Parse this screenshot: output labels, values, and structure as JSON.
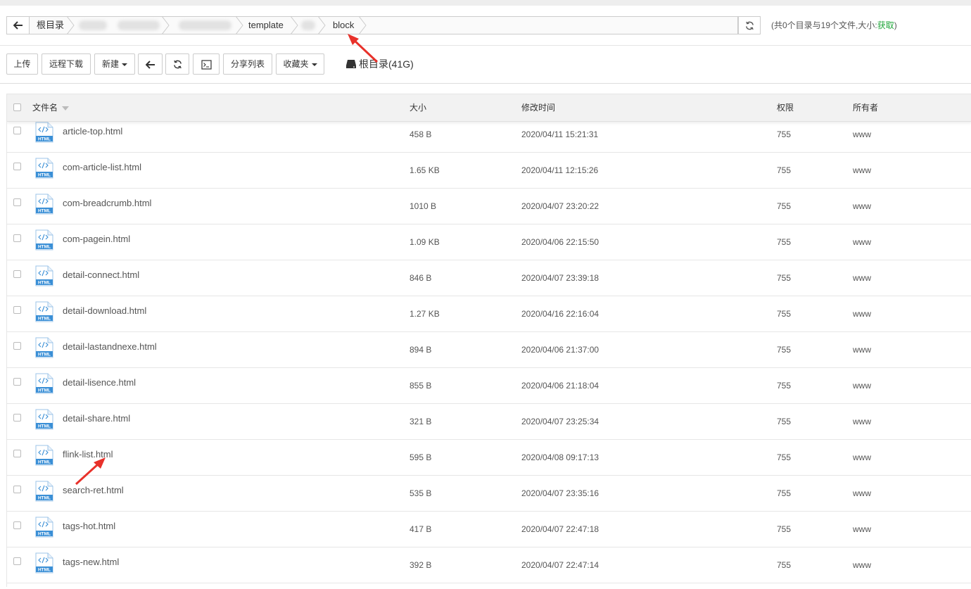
{
  "breadcrumb": {
    "root": "根目录",
    "template": "template",
    "block": "block"
  },
  "dir_info": {
    "prefix": "(共0个目录与19个文件,大小:",
    "link": "获取",
    "suffix": ")"
  },
  "toolbar": {
    "upload": "上传",
    "remote_download": "远程下载",
    "new": "新建",
    "share_list": "分享列表",
    "favorites": "收藏夹",
    "disk": "根目录(41G)"
  },
  "table": {
    "headers": {
      "name": "文件名",
      "size": "大小",
      "mtime": "修改时间",
      "perm": "权限",
      "owner": "所有者"
    },
    "icon_badge": "HTML",
    "rows": [
      {
        "name": "article-top.html",
        "size": "458 B",
        "mtime": "2020/04/11 15:21:31",
        "perm": "755",
        "owner": "www"
      },
      {
        "name": "com-article-list.html",
        "size": "1.65 KB",
        "mtime": "2020/04/11 12:15:26",
        "perm": "755",
        "owner": "www"
      },
      {
        "name": "com-breadcrumb.html",
        "size": "1010 B",
        "mtime": "2020/04/07 23:20:22",
        "perm": "755",
        "owner": "www"
      },
      {
        "name": "com-pagein.html",
        "size": "1.09 KB",
        "mtime": "2020/04/06 22:15:50",
        "perm": "755",
        "owner": "www"
      },
      {
        "name": "detail-connect.html",
        "size": "846 B",
        "mtime": "2020/04/07 23:39:18",
        "perm": "755",
        "owner": "www"
      },
      {
        "name": "detail-download.html",
        "size": "1.27 KB",
        "mtime": "2020/04/16 22:16:04",
        "perm": "755",
        "owner": "www"
      },
      {
        "name": "detail-lastandnexe.html",
        "size": "894 B",
        "mtime": "2020/04/06 21:37:00",
        "perm": "755",
        "owner": "www"
      },
      {
        "name": "detail-lisence.html",
        "size": "855 B",
        "mtime": "2020/04/06 21:18:04",
        "perm": "755",
        "owner": "www"
      },
      {
        "name": "detail-share.html",
        "size": "321 B",
        "mtime": "2020/04/07 23:25:34",
        "perm": "755",
        "owner": "www"
      },
      {
        "name": "flink-list.html",
        "size": "595 B",
        "mtime": "2020/04/08 09:17:13",
        "perm": "755",
        "owner": "www"
      },
      {
        "name": "search-ret.html",
        "size": "535 B",
        "mtime": "2020/04/07 23:35:16",
        "perm": "755",
        "owner": "www"
      },
      {
        "name": "tags-hot.html",
        "size": "417 B",
        "mtime": "2020/04/07 22:47:18",
        "perm": "755",
        "owner": "www"
      },
      {
        "name": "tags-new.html",
        "size": "392 B",
        "mtime": "2020/04/07 22:47:14",
        "perm": "755",
        "owner": "www"
      }
    ]
  },
  "colors": {
    "accent_green": "#20a53a",
    "icon_blue": "#3a8fd6",
    "annotation_red": "#e8312a"
  },
  "icons": {
    "back": "arrow-left-icon",
    "refresh": "refresh-icon",
    "terminal": "terminal-icon",
    "disk": "hard-drive-icon",
    "file": "html-file-icon"
  }
}
